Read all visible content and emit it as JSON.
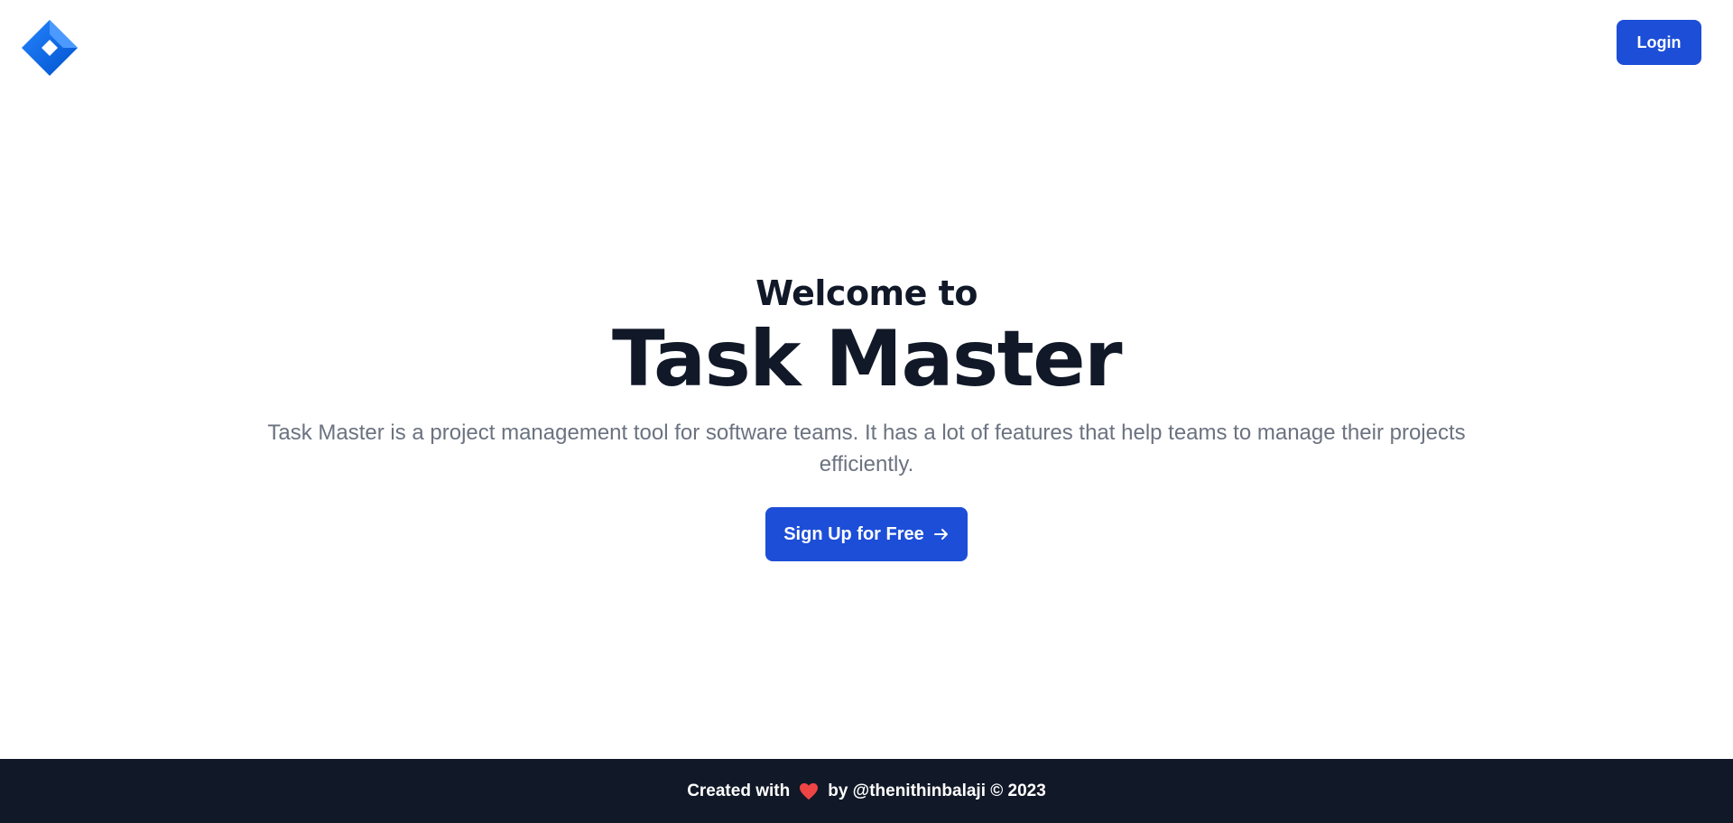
{
  "header": {
    "logo_icon": "diamond-logo-icon",
    "login_label": "Login"
  },
  "hero": {
    "welcome": "Welcome to",
    "title": "Task Master",
    "description": "Task Master is a project management tool for software teams. It has a lot of features that help teams to manage their projects efficiently.",
    "signup_label": "Sign Up for Free",
    "signup_icon": "arrow-right-icon"
  },
  "footer": {
    "prefix": "Created with",
    "heart_icon": "heart-icon",
    "suffix": "by @thenithinbalaji © 2023"
  },
  "colors": {
    "primary": "#1d4ed8",
    "dark": "#111827",
    "muted": "#6b7280",
    "logo_light": "#2684ff",
    "logo_dark": "#0052cc",
    "heart": "#ef4444"
  }
}
